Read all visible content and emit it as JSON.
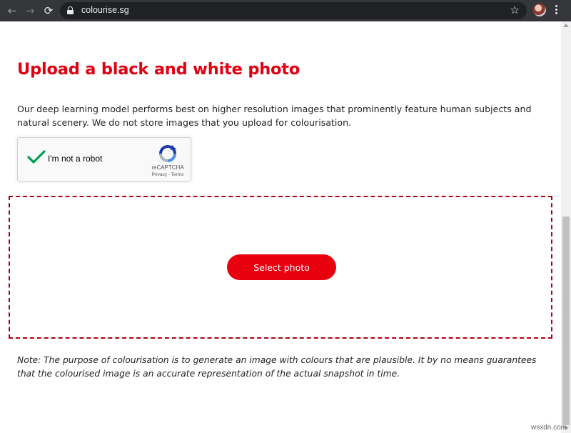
{
  "browser": {
    "url": "colourise.sg",
    "back_icon": "←",
    "forward_icon": "→",
    "reload_icon": "⟳",
    "bookmark_icon": "☆"
  },
  "page": {
    "title": "Upload a black and white photo",
    "intro": "Our deep learning model performs best on higher resolution images that prominently feature human subjects and natural scenery. We do not store images that you upload for colourisation.",
    "recaptcha": {
      "label": "I'm not a robot",
      "brand": "reCAPTCHA",
      "links": "Privacy - Terms",
      "checked": true
    },
    "select_button": "Select photo",
    "note": "Note: The purpose of colourisation is to generate an image with colours that are plausible. It by no means guarantees that the colourised image is an accurate representation of the actual snapshot in time."
  },
  "watermark": "wsxdn.com",
  "colors": {
    "accent": "#e0000f",
    "dropzone_border": "#b30010",
    "check": "#009e55"
  }
}
